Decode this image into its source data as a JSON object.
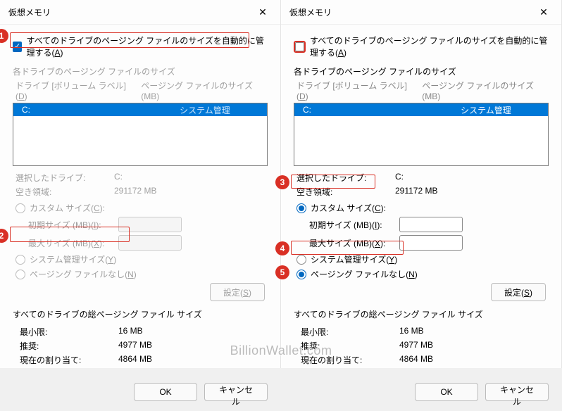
{
  "dialog_title": "仮想メモリ",
  "auto_manage_label_pre": "すべてのドライブのページング ファイルのサイズを自動的に管理する(",
  "auto_manage_key": "A",
  "auto_manage_label_post": ")",
  "each_drive_label": "各ドライブのページング ファイルのサイズ",
  "list_header_drive_pre": "ドライブ  [ボリューム ラベル](",
  "list_header_drive_key": "D",
  "list_header_drive_post": ")",
  "list_header_size": "ページング ファイルのサイズ (MB)",
  "drive_letter": "C:",
  "drive_status": "システム管理",
  "selected_drive_label": "選択したドライブ:",
  "selected_drive_value": "C:",
  "free_space_label": "空き領域:",
  "free_space_value": "291172 MB",
  "custom_size_label_pre": "カスタム サイズ(",
  "custom_size_key": "C",
  "custom_size_label_post": "):",
  "initial_size_label_pre": "初期サイズ (MB)(",
  "initial_size_key": "I",
  "initial_size_label_post": "):",
  "max_size_label_pre": "最大サイズ (MB)(",
  "max_size_key": "X",
  "max_size_label_post": "):",
  "system_managed_label_pre": "システム管理サイズ(",
  "system_managed_key": "Y",
  "system_managed_label_post": ")",
  "no_paging_label_pre": "ページング ファイルなし(",
  "no_paging_key": "N",
  "no_paging_label_post": ")",
  "set_btn_pre": "設定(",
  "set_btn_key": "S",
  "set_btn_post": ")",
  "total_label": "すべてのドライブの総ページング ファイル サイズ",
  "min_label": "最小限:",
  "min_value": "16 MB",
  "rec_label": "推奨:",
  "rec_value": "4977 MB",
  "cur_label": "現在の割り当て:",
  "cur_value": "4864 MB",
  "ok_btn": "OK",
  "cancel_btn": "キャンセル",
  "watermark": "BillionWallet.com",
  "badges": {
    "b1": "1",
    "b2": "2",
    "b3": "3",
    "b4": "4",
    "b5": "5"
  }
}
